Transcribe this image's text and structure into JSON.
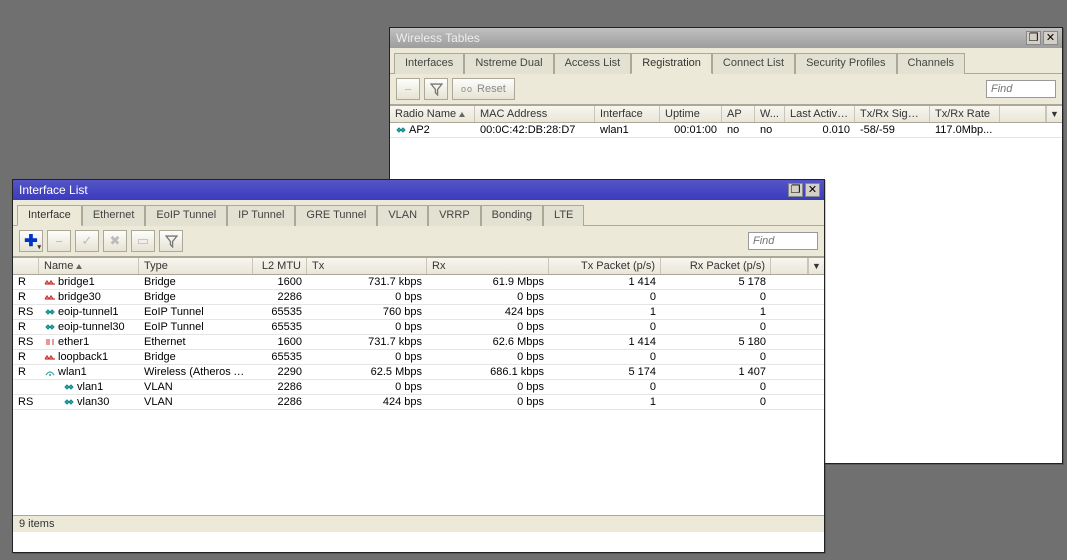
{
  "wireless": {
    "title": "Wireless Tables",
    "tabs": [
      "Interfaces",
      "Nstreme Dual",
      "Access List",
      "Registration",
      "Connect List",
      "Security Profiles",
      "Channels"
    ],
    "active_tab": 3,
    "reset_label": "Reset",
    "find_placeholder": "Find",
    "columns": [
      "Radio Name",
      "MAC Address",
      "Interface",
      "Uptime",
      "AP",
      "W...",
      "Last Activit...",
      "Tx/Rx Signal ...",
      "Tx/Rx Rate"
    ],
    "rows": [
      {
        "radio": "AP2",
        "mac": "00:0C:42:DB:28:D7",
        "iface": "wlan1",
        "uptime": "00:01:00",
        "ap": "no",
        "wds": "no",
        "last": "0.010",
        "signal": "-58/-59",
        "rate": "117.0Mbp..."
      }
    ]
  },
  "iflist": {
    "title": "Interface List",
    "tabs": [
      "Interface",
      "Ethernet",
      "EoIP Tunnel",
      "IP Tunnel",
      "GRE Tunnel",
      "VLAN",
      "VRRP",
      "Bonding",
      "LTE"
    ],
    "active_tab": 0,
    "find_placeholder": "Find",
    "columns": [
      "",
      "Name",
      "Type",
      "L2 MTU",
      "Tx",
      "Rx",
      "Tx Packet (p/s)",
      "Rx Packet (p/s)"
    ],
    "rows": [
      {
        "f": "R",
        "icon": "bridge",
        "name": "bridge1",
        "type": "Bridge",
        "mtu": "1600",
        "tx": "731.7 kbps",
        "rx": "61.9 Mbps",
        "txp": "1 414",
        "rxp": "5 178"
      },
      {
        "f": "R",
        "icon": "bridge",
        "name": "bridge30",
        "type": "Bridge",
        "mtu": "2286",
        "tx": "0 bps",
        "rx": "0 bps",
        "txp": "0",
        "rxp": "0"
      },
      {
        "f": "RS",
        "icon": "tunnel",
        "name": "eoip-tunnel1",
        "type": "EoIP Tunnel",
        "mtu": "65535",
        "tx": "760 bps",
        "rx": "424 bps",
        "txp": "1",
        "rxp": "1"
      },
      {
        "f": "R",
        "icon": "tunnel",
        "name": "eoip-tunnel30",
        "type": "EoIP Tunnel",
        "mtu": "65535",
        "tx": "0 bps",
        "rx": "0 bps",
        "txp": "0",
        "rxp": "0"
      },
      {
        "f": "RS",
        "icon": "eth",
        "name": "ether1",
        "type": "Ethernet",
        "mtu": "1600",
        "tx": "731.7 kbps",
        "rx": "62.6 Mbps",
        "txp": "1 414",
        "rxp": "5 180"
      },
      {
        "f": "R",
        "icon": "bridge",
        "name": "loopback1",
        "type": "Bridge",
        "mtu": "65535",
        "tx": "0 bps",
        "rx": "0 bps",
        "txp": "0",
        "rxp": "0"
      },
      {
        "f": "R",
        "icon": "wlan",
        "name": "wlan1",
        "type": "Wireless (Atheros AR9...",
        "mtu": "2290",
        "tx": "62.5 Mbps",
        "rx": "686.1 kbps",
        "txp": "5 174",
        "rxp": "1 407"
      },
      {
        "f": "",
        "icon": "vlan",
        "name": "vlan1",
        "type": "VLAN",
        "mtu": "2286",
        "tx": "0 bps",
        "rx": "0 bps",
        "txp": "0",
        "rxp": "0",
        "indent": true
      },
      {
        "f": "RS",
        "icon": "vlan",
        "name": "vlan30",
        "type": "VLAN",
        "mtu": "2286",
        "tx": "424 bps",
        "rx": "0 bps",
        "txp": "1",
        "rxp": "0",
        "indent": true
      }
    ],
    "status": "9 items"
  }
}
